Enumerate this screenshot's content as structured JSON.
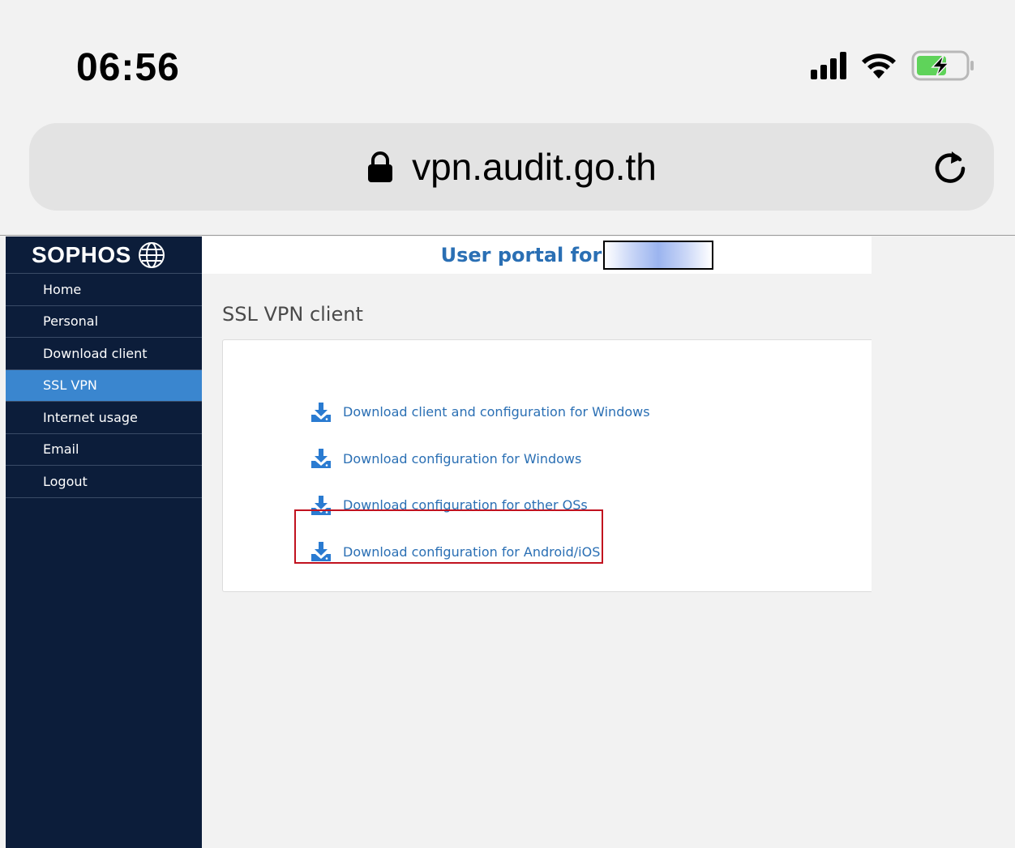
{
  "status_bar": {
    "time": "06:56",
    "icons": [
      "signal-icon",
      "wifi-icon",
      "battery-charging-icon"
    ]
  },
  "browser": {
    "url": "vpn.audit.go.th",
    "lock_icon": "lock-icon",
    "reload_icon": "reload-icon"
  },
  "sidebar": {
    "brand": "SOPHOS",
    "brand_icon": "globe-icon",
    "items": [
      {
        "label": "Home"
      },
      {
        "label": "Personal"
      },
      {
        "label": "Download client"
      },
      {
        "label": "SSL VPN",
        "active": true
      },
      {
        "label": "Internet usage"
      },
      {
        "label": "Email"
      },
      {
        "label": "Logout"
      }
    ]
  },
  "main": {
    "header_title": "User portal for",
    "section_title": "SSL VPN client",
    "downloads": [
      {
        "label": "Download client and configuration for Windows"
      },
      {
        "label": "Download configuration for Windows"
      },
      {
        "label": "Download configuration for other OSs"
      },
      {
        "label": "Download configuration for Android/iOS",
        "highlighted": true
      }
    ]
  },
  "colors": {
    "sidebar_bg": "#0c1d3a",
    "active_item": "#3a86cf",
    "link": "#2a6fb4",
    "highlight_border": "#c1121f"
  }
}
